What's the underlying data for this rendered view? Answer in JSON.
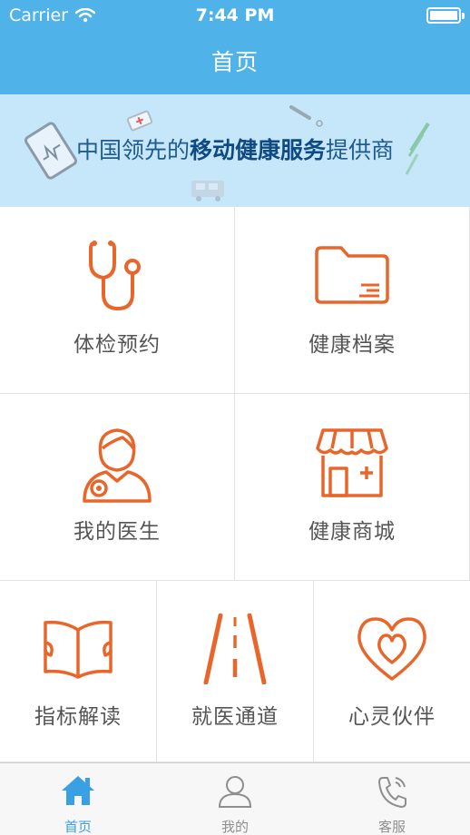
{
  "status_bar": {
    "carrier": "Carrier",
    "time": "7:44 PM"
  },
  "nav": {
    "title": "首页"
  },
  "banner": {
    "slogan_pre": "中国领先的",
    "slogan_bold": "移动健康服务",
    "slogan_post": "提供商"
  },
  "grid": {
    "items": [
      {
        "label": "体检预约",
        "icon": "stethoscope-icon"
      },
      {
        "label": "健康档案",
        "icon": "folder-icon"
      },
      {
        "label": "我的医生",
        "icon": "doctor-icon"
      },
      {
        "label": "健康商城",
        "icon": "store-icon"
      },
      {
        "label": "指标解读",
        "icon": "open-book-icon"
      },
      {
        "label": "就医通道",
        "icon": "road-icon"
      },
      {
        "label": "心灵伙伴",
        "icon": "heart-icon"
      }
    ]
  },
  "tabs": [
    {
      "label": "首页",
      "icon": "home-icon",
      "active": true
    },
    {
      "label": "我的",
      "icon": "user-icon",
      "active": false
    },
    {
      "label": "客服",
      "icon": "phone-icon",
      "active": false
    }
  ],
  "colors": {
    "primary": "#4fb3ea",
    "accent": "#e8662a",
    "banner_bg": "#c6e6fa",
    "tab_active": "#3aa0e4"
  }
}
